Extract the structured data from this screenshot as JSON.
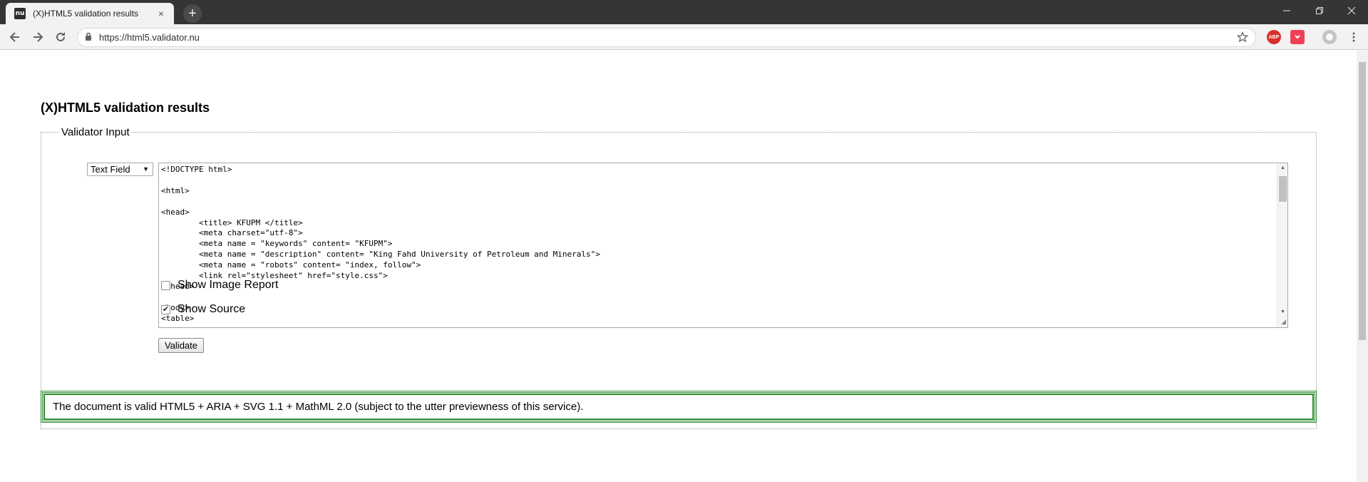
{
  "browser": {
    "tab_favicon": "nu",
    "tab_title": "(X)HTML5 validation results",
    "tab_close": "×",
    "new_tab": "+",
    "url": "https://html5.validator.nu",
    "extensions": {
      "abp_label": "ABP"
    }
  },
  "page": {
    "title": "(X)HTML5 validation results",
    "fieldset_legend": "Validator Input",
    "input_mode": {
      "selected": "Text Field"
    },
    "source_code": "<!DOCTYPE html>\n\n<html>\n\n<head>\n\t<title> KFUPM </title>\n\t<meta charset=\"utf-8\">\n\t<meta name = \"keywords\" content= \"KFUPM\">\n\t<meta name = \"description\" content= \"King Fahd University of Petroleum and Minerals\">\n\t<meta name = \"robots\" content= \"index, follow\">\n\t<link rel=\"stylesheet\" href=\"style.css\">\n</head>\n\n<body>\n<table>",
    "options": {
      "show_image_report": {
        "label": "Show Image Report",
        "checked": false
      },
      "show_source": {
        "label": "Show Source",
        "checked": true
      }
    },
    "validate_label": "Validate",
    "result_message": "The document is valid HTML5 + ARIA + SVG 1.1 + MathML 2.0 (subject to the utter previewness of this service)."
  },
  "colors": {
    "tabbar": "#353535",
    "toolbar": "#f2f2f2",
    "success_border": "#2f8a2f",
    "abp": "#d9302c",
    "pocket": "#ef4056"
  }
}
